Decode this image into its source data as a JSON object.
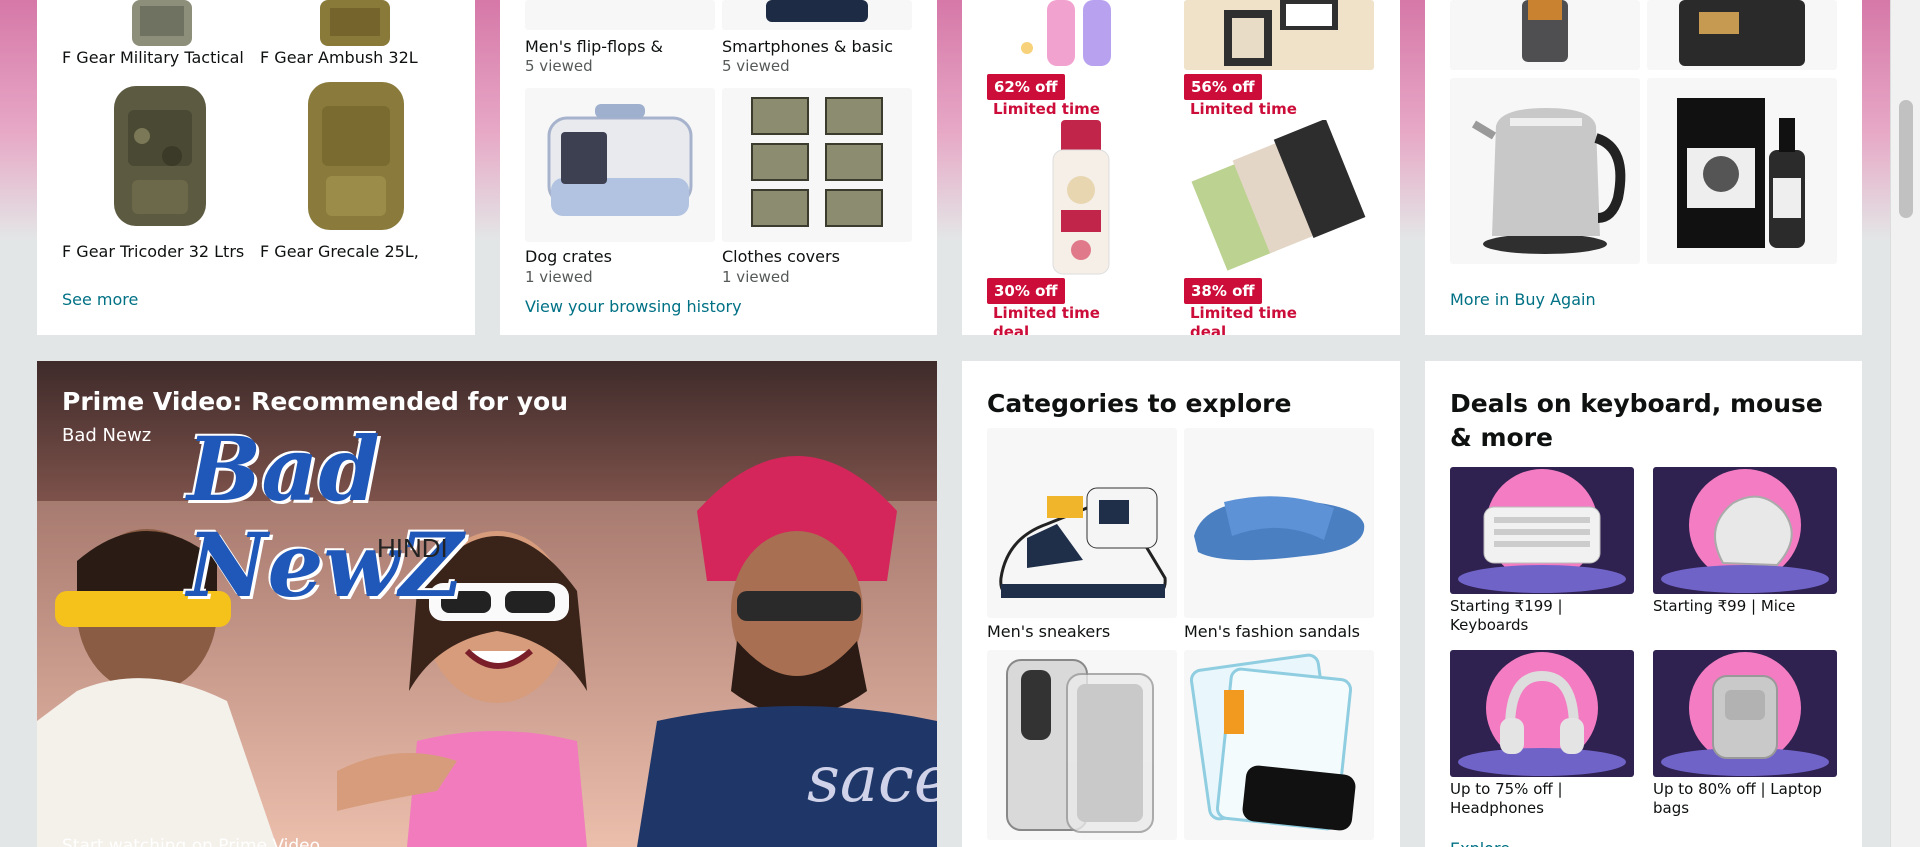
{
  "card1": {
    "items": [
      {
        "label": "F Gear Military Tactical"
      },
      {
        "label": "F Gear Ambush 32L"
      },
      {
        "label": "F Gear Tricoder 32 Ltrs"
      },
      {
        "label": "F Gear Grecale 25L,"
      }
    ],
    "link": "See more"
  },
  "card2": {
    "items": [
      {
        "label": "Men's flip-flops &",
        "meta": "5 viewed"
      },
      {
        "label": "Smartphones & basic",
        "meta": "5 viewed"
      },
      {
        "label": "Dog crates",
        "meta": "1 viewed"
      },
      {
        "label": "Clothes covers",
        "meta": "1 viewed"
      }
    ],
    "link": "View your browsing history"
  },
  "card3": {
    "items": [
      {
        "badge": "62% off",
        "deal": "Limited time deal"
      },
      {
        "badge": "56% off",
        "deal": "Limited time deal"
      },
      {
        "badge": "30% off",
        "deal": "Limited time deal"
      },
      {
        "badge": "38% off",
        "deal": "Limited time deal"
      }
    ]
  },
  "card4": {
    "link": "More in Buy Again"
  },
  "prime": {
    "title": "Prime Video: Recommended for you",
    "subtitle": "Bad Newz",
    "logo_text": "Bad NewZ",
    "logo_sub": "HINDI",
    "cta": "Start watching on Prime Video"
  },
  "categories": {
    "title": "Categories to explore",
    "items": [
      {
        "label": "Men's sneakers"
      },
      {
        "label": "Men's fashion sandals"
      }
    ]
  },
  "deals": {
    "title": "Deals on keyboard, mouse & more",
    "items": [
      {
        "label": "Starting ₹199 | Keyboards"
      },
      {
        "label": "Starting ₹99 | Mice"
      },
      {
        "label": "Up to 75% off | Headphones"
      },
      {
        "label": "Up to 80% off | Laptop bags"
      }
    ],
    "link": "Explore"
  },
  "colors": {
    "deal_red": "#cc0c39",
    "link_teal": "#007185",
    "page_bg": "#e3e6e6"
  }
}
